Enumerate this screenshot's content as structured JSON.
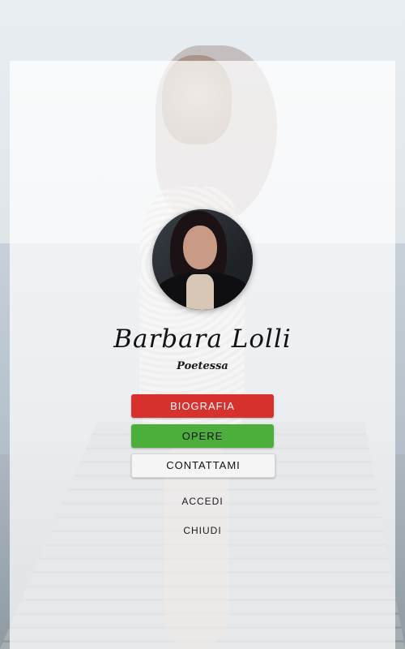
{
  "profile": {
    "name": "Barbara Lolli",
    "role": "Poetessa"
  },
  "menu": {
    "biografia": "BIOGRAFIA",
    "opere": "OPERE",
    "contattami": "CONTATTAMI",
    "accedi": "ACCEDI",
    "chiudi": "CHIUDI"
  },
  "colors": {
    "biografia": "#d7312e",
    "opere": "#4caf3c",
    "contattami": "#f5f5f5",
    "overlay": "rgba(255,255,255,0.72)"
  }
}
